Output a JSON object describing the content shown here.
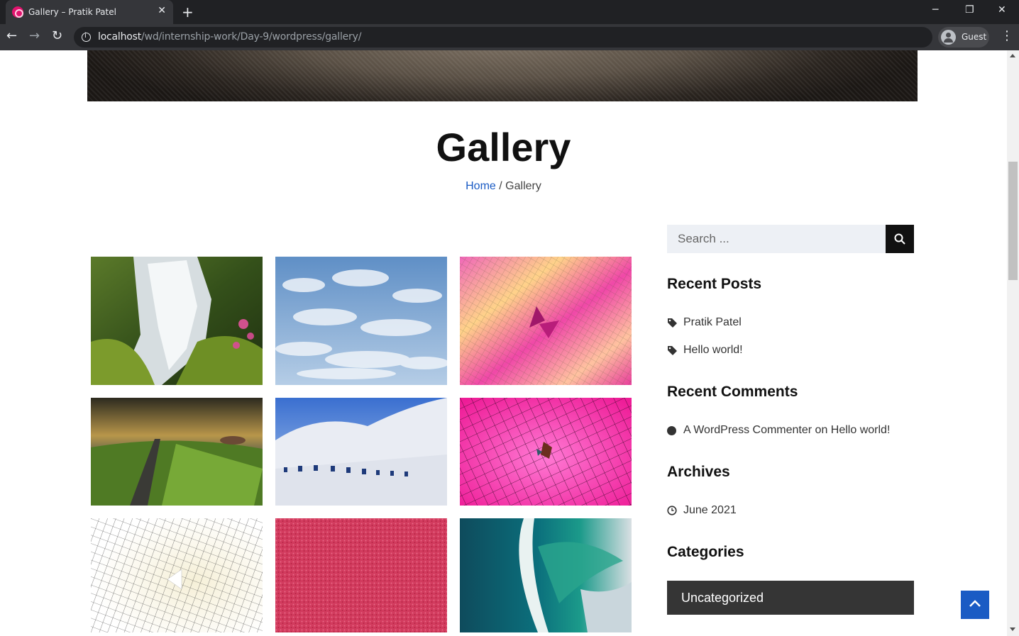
{
  "browser": {
    "tab_title": "Gallery – Pratik Patel",
    "url_host": "localhost",
    "url_path": "/wd/internship-work/Day-9/wordpress/gallery/",
    "profile_label": "Guest",
    "icons": [
      "back-icon",
      "forward-icon",
      "reload-icon",
      "info-icon",
      "profile-icon",
      "menu-icon",
      "minimize-icon",
      "restore-icon",
      "close-icon",
      "new-tab-icon"
    ]
  },
  "page": {
    "title": "Gallery",
    "breadcrumb": {
      "home": "Home",
      "separator": "/",
      "current": "Gallery"
    }
  },
  "gallery": {
    "images": [
      {
        "name": "waterfall-image"
      },
      {
        "name": "sky-clouds-image"
      },
      {
        "name": "pink-pattern-image"
      },
      {
        "name": "road-landscape-image"
      },
      {
        "name": "white-building-image"
      },
      {
        "name": "magenta-tiles-image"
      },
      {
        "name": "grid-pattern-image"
      },
      {
        "name": "red-texture-image"
      },
      {
        "name": "ocean-wave-image"
      }
    ]
  },
  "sidebar": {
    "search_placeholder": "Search ...",
    "recent_posts_title": "Recent Posts",
    "recent_posts": [
      "Pratik Patel",
      "Hello world!"
    ],
    "recent_comments_title": "Recent Comments",
    "recent_comments": [
      {
        "author": "A WordPress Commenter",
        "on": "on",
        "post": "Hello world!"
      }
    ],
    "archives_title": "Archives",
    "archives": [
      "June 2021"
    ],
    "categories_title": "Categories",
    "categories": [
      "Uncategorized"
    ]
  },
  "colors": {
    "link": "#1a5bc4",
    "dark": "#111111",
    "category_bg": "#353535",
    "back_to_top": "#1a5bc4"
  }
}
